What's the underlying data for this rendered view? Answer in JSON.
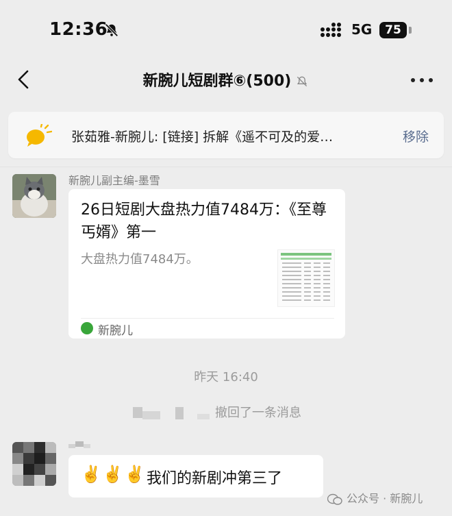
{
  "status_bar": {
    "time": "12:36",
    "network": "5G",
    "battery": "75"
  },
  "nav": {
    "title": "新腕儿短剧群⑥(500)"
  },
  "pinned": {
    "text": "张茹雅-新腕儿: [链接] 拆解《遥不可及的爱…",
    "remove_label": "移除"
  },
  "messages": {
    "m1": {
      "sender": "新腕儿副主编-墨雪",
      "card_title": "26日短剧大盘热力值7484万：《至尊丐婿》第一",
      "card_desc": "大盘热力值7484万。",
      "card_source": "新腕儿"
    },
    "timestamp": "昨天 16:40",
    "recall": "撤回了一条消息",
    "m2": {
      "emoji": "✌️✌️✌️",
      "text": "我们的新剧冲第三了"
    }
  },
  "watermark": "公众号 · 新腕儿",
  "colors": {
    "background": "#ededed",
    "remove_link": "#5a6d8f",
    "bulb": "#f5b800"
  },
  "icons": [
    "bell-off-icon",
    "signal-icon",
    "back-icon",
    "mute-icon",
    "more-icon",
    "bulb-icon",
    "source-icon",
    "wechat-icon"
  ]
}
